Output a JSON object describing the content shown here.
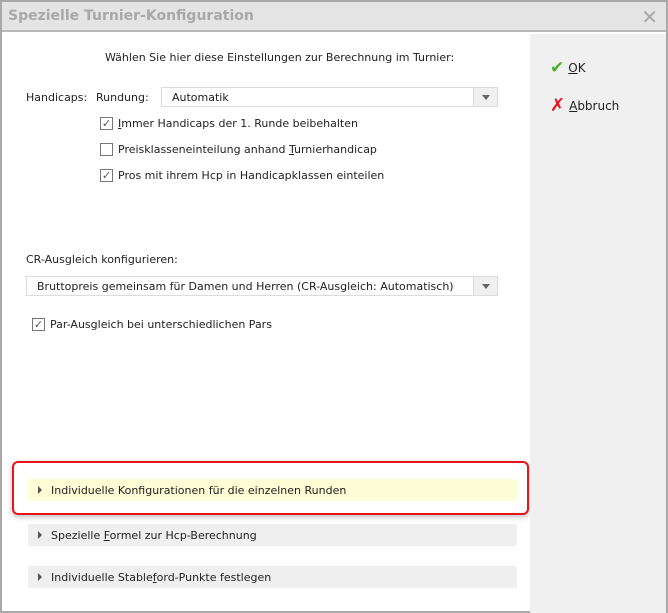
{
  "title": "Spezielle Turnier-Konfiguration",
  "intro": "Wählen Sie hier diese Einstellungen zur Berechnung im Turnier:",
  "handicaps_label": "Handicaps:",
  "rundung_label": "Rundung:",
  "rundung_value": "Automatik",
  "checkboxes": [
    {
      "pre": "",
      "key": "I",
      "post": "mmer Handicaps der 1. Runde beibehalten",
      "checked": true
    },
    {
      "pre": "Preisklasseneinteilung anhand ",
      "key": "T",
      "post": "urnierhandicap",
      "checked": false
    },
    {
      "pre": "Pros mit ihrem Hcp in Handicapklassen einteilen",
      "key": "",
      "post": "",
      "checked": true
    }
  ],
  "cr_label": "CR-Ausgleich konfigurieren:",
  "cr_value": "Bruttopreis gemeinsam für Damen und Herren (CR-Ausgleich: Automatisch)",
  "par_checkbox": {
    "label": "Par-Ausgleich bei unterschiedlichen Pars",
    "checked": true
  },
  "sections": [
    {
      "pre": "Individuelle Konfigurationen für die einzelnen Runden",
      "key": "",
      "post": "",
      "highlighted": true
    },
    {
      "pre": "Spezielle ",
      "key": "F",
      "post": "ormel zur Hcp-Berechnung",
      "highlighted": false
    },
    {
      "pre": "Individuelle Stable",
      "key": "f",
      "post": "ord-Punkte festlegen",
      "highlighted": false
    }
  ],
  "ok": {
    "key": "O",
    "post": "K"
  },
  "cancel": {
    "key": "A",
    "post": "bbruch"
  },
  "colors": {
    "highlight_bg": "#fdfdd6",
    "highlight_border": "#e8141c",
    "ok": "#4caf2a",
    "cancel": "#e8141c"
  }
}
